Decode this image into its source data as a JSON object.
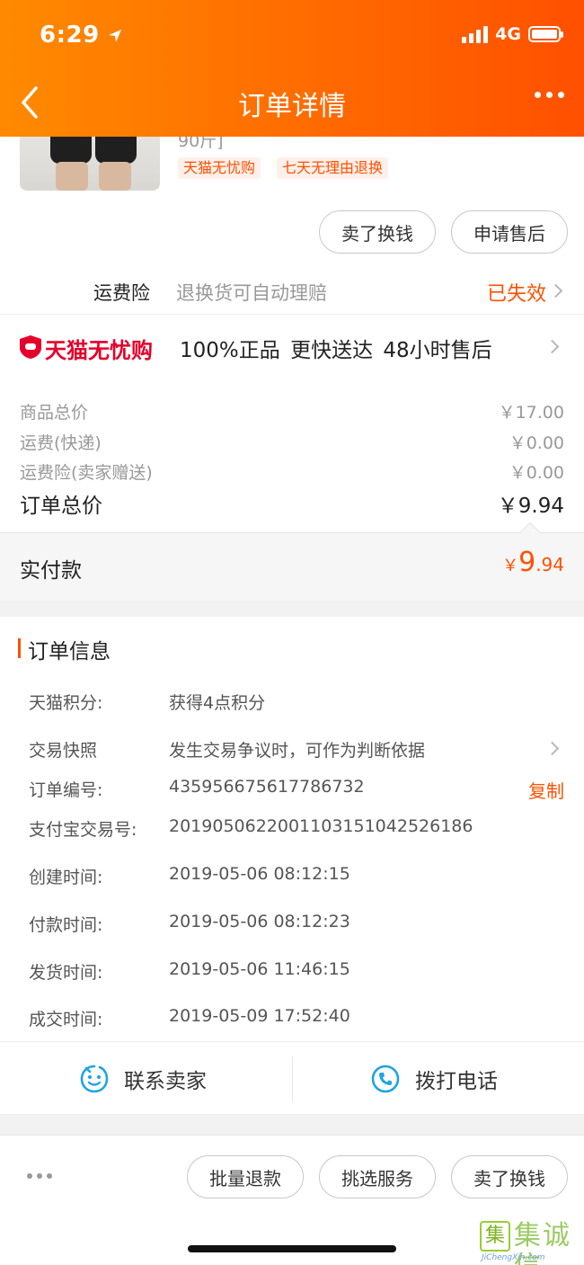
{
  "status_bar": {
    "time": "6:29",
    "network": "4G"
  },
  "nav": {
    "title": "订单详情"
  },
  "product": {
    "spec_partial": "90斤]",
    "tags": [
      "天猫无忧购",
      "七天无理由退换"
    ]
  },
  "item_actions": {
    "sell_btn": "卖了换钱",
    "aftersale_btn": "申请售后"
  },
  "insurance": {
    "name": "运费险",
    "desc": "退换货可自动理赔",
    "status": "已失效"
  },
  "tmall_assurance": {
    "brand": "天猫无忧购",
    "features": "100%正品  更快送达  48小时售后"
  },
  "price_summary": {
    "items_total_label": "商品总价",
    "items_total": "￥17.00",
    "shipping_label": "运费(快递)",
    "shipping": "￥0.00",
    "insurance_label": "运费险(卖家赠送)",
    "insurance": "￥0.00",
    "order_total_label": "订单总价",
    "order_total": "￥9.94"
  },
  "payment": {
    "label": "实付款",
    "currency": "￥",
    "integer": "9",
    "decimal": ".94"
  },
  "order_info": {
    "title": "订单信息",
    "points_label": "天猫积分:",
    "points_value": "获得4点积分",
    "snapshot_label": "交易快照",
    "snapshot_value": "发生交易争议时，可作为判断依据",
    "order_no_label": "订单编号:",
    "order_no": "435956675617786732",
    "copy": "复制",
    "alipay_label": "支付宝交易号:",
    "alipay_no": "2019050622001103151042526186",
    "created_label": "创建时间:",
    "created": "2019-05-06 08:12:15",
    "paid_label": "付款时间:",
    "paid": "2019-05-06 08:12:23",
    "shipped_label": "发货时间:",
    "shipped": "2019-05-06 11:46:15",
    "completed_label": "成交时间:",
    "completed": "2019-05-09 17:52:40"
  },
  "contact": {
    "seller": "联系卖家",
    "call": "拨打电话"
  },
  "bottom_actions": {
    "batch_refund": "批量退款",
    "choose_service": "挑选服务",
    "sell": "卖了换钱"
  },
  "watermark": {
    "text": "集诚信",
    "url": "JiChengXin.com"
  },
  "colors": {
    "accent": "#ff5000",
    "tmall_red": "#e4002b",
    "header_gradient_start": "#ff8a00"
  },
  "icons": [
    "location-arrow-icon",
    "back-arrow-icon",
    "more-icon",
    "tmall-shield-icon",
    "chevron-right-icon",
    "smiley-chat-icon",
    "phone-icon"
  ]
}
